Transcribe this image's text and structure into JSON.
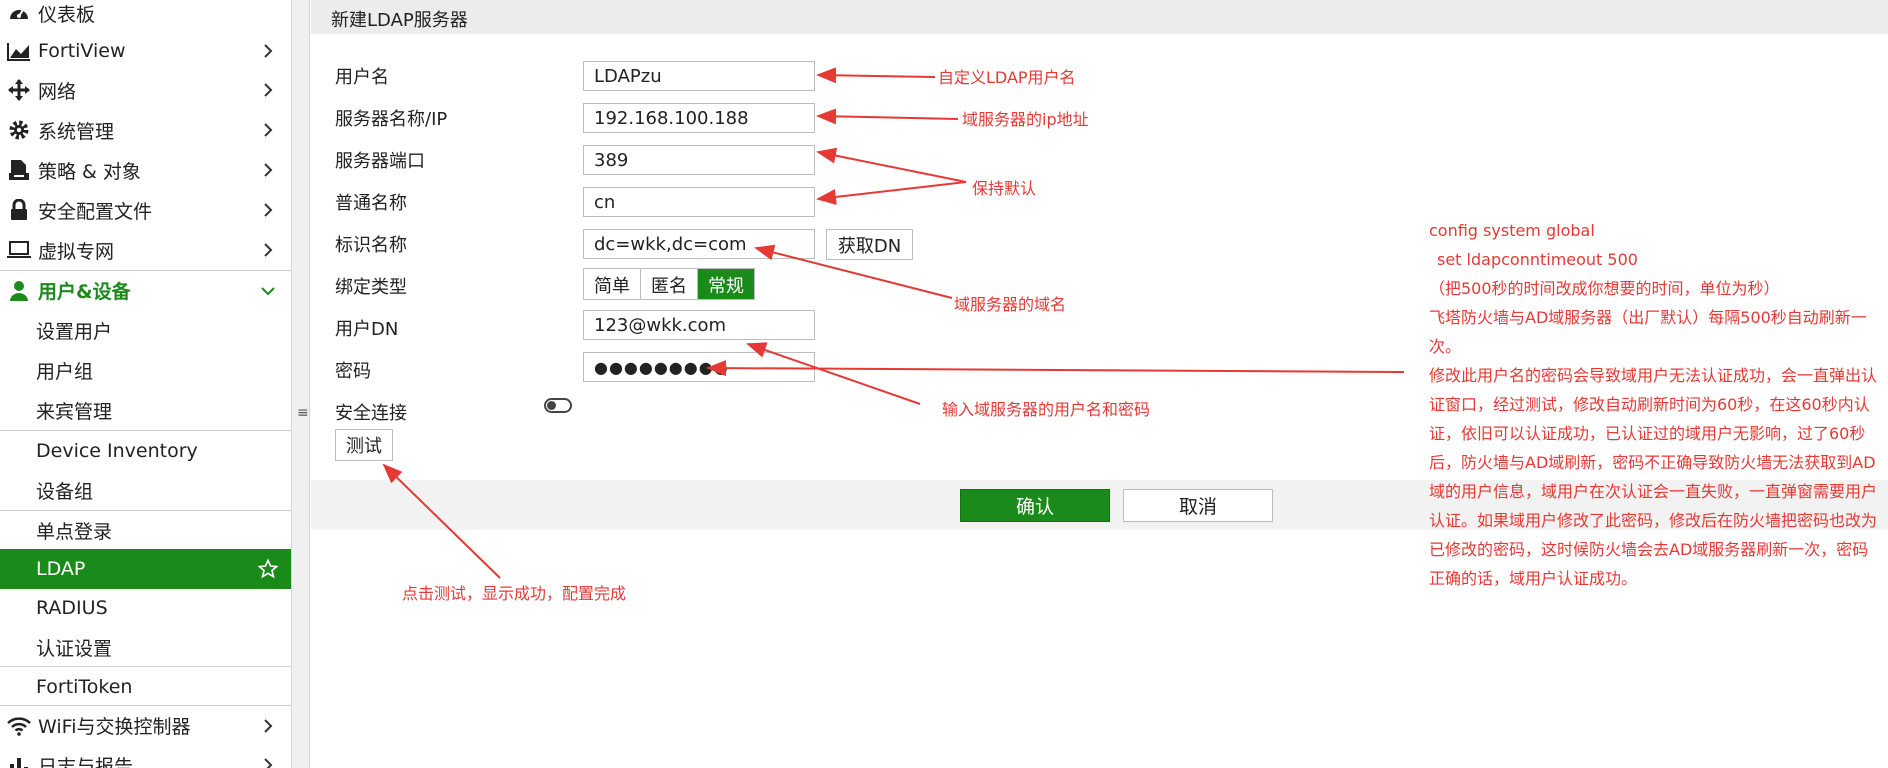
{
  "sidebar": {
    "items": [
      {
        "label": "仪表板",
        "icon": "dashboard-icon"
      },
      {
        "label": "FortiView",
        "icon": "chart-icon"
      },
      {
        "label": "网络",
        "icon": "network-move-icon"
      },
      {
        "label": "系统管理",
        "icon": "gear-icon"
      },
      {
        "label": "策略 & 对象",
        "icon": "policy-icon"
      },
      {
        "label": "安全配置文件",
        "icon": "lock-icon"
      },
      {
        "label": "虚拟专网",
        "icon": "laptop-icon"
      },
      {
        "label": "用户&设备",
        "icon": "user-icon"
      },
      {
        "label": "设置用户"
      },
      {
        "label": "用户组"
      },
      {
        "label": "来宾管理"
      },
      {
        "label": "Device Inventory"
      },
      {
        "label": "设备组"
      },
      {
        "label": "单点登录"
      },
      {
        "label": "LDAP"
      },
      {
        "label": "RADIUS"
      },
      {
        "label": "认证设置"
      },
      {
        "label": "FortiToken"
      },
      {
        "label": "WiFi与交换控制器",
        "icon": "wifi-icon"
      },
      {
        "label": "日志与报告",
        "icon": "report-icon"
      }
    ]
  },
  "dialog": {
    "title": "新建LDAP服务器",
    "fields": {
      "username": {
        "label": "用户名",
        "value": "LDAPzu"
      },
      "server": {
        "label": "服务器名称/IP",
        "value": "192.168.100.188"
      },
      "port": {
        "label": "服务器端口",
        "value": "389"
      },
      "cn": {
        "label": "普通名称",
        "value": "cn"
      },
      "dn": {
        "label": "标识名称",
        "value": "dc=wkk,dc=com"
      },
      "bind": {
        "label": "绑定类型"
      },
      "userdn": {
        "label": "用户DN",
        "value": "123@wkk.com"
      },
      "password": {
        "label": "密码",
        "value": "●●●●●●●●●"
      },
      "secure": {
        "label": "安全连接"
      }
    },
    "get_dn_label": "获取DN",
    "bind_options": [
      "简单",
      "匿名",
      "常规"
    ],
    "bind_selected": "常规",
    "test_label": "测试",
    "ok_label": "确认",
    "cancel_label": "取消"
  },
  "annotations": {
    "username": "自定义LDAP用户名",
    "server_ip": "域服务器的ip地址",
    "default": "保持默认",
    "domain": "域服务器的域名",
    "userpass": "输入域服务器的用户名和密码",
    "test": "点击测试，显示成功，配置完成",
    "config": [
      "config system global",
      "  set ldapconntimeout 500",
      "（把500秒的时间改成你想要的时间，单位为秒）",
      "飞塔防火墙与AD域服务器（出厂默认）每隔500秒自动刷新一次。",
      "修改此用户名的密码会导致域用户无法认证成功，会一直弹出认证窗口，经过测试，修改自动刷新时间为60秒，在这60秒内认证，依旧可以认证成功，已认证过的域用户无影响，过了60秒后，防火墙与AD域刷新，密码不正确导致防火墙无法获取到AD域的用户信息，域用户在次认证会一直失败，一直弹窗需要用户认证。如果域用户修改了此密码，修改后在防火墙把密码也改为已修改的密码，这时候防火墙会去AD域服务器刷新一次，密码正确的话，域用户认证成功。"
    ]
  },
  "colors": {
    "accent_green": "#1a8a1a",
    "annotation_red": "#e53935"
  }
}
